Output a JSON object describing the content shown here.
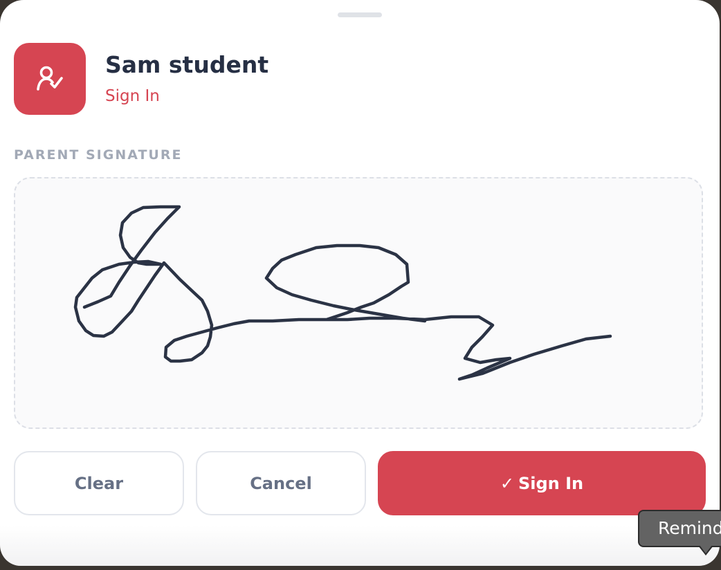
{
  "sheet": {
    "student_name": "Sam student",
    "action_label": "Sign In",
    "avatar_icon": "user-check-icon"
  },
  "signature": {
    "section_label": "PARENT SIGNATURE",
    "stroke_color": "#2b3345"
  },
  "buttons": {
    "clear_label": "Clear",
    "cancel_label": "Cancel",
    "confirm_check": "✓",
    "confirm_label": "Sign In"
  },
  "tooltip": {
    "text": "Remind"
  },
  "colors": {
    "accent": "#d64552",
    "title": "#262f44",
    "muted_label": "#a2a9b6",
    "outline_text": "#667085"
  }
}
